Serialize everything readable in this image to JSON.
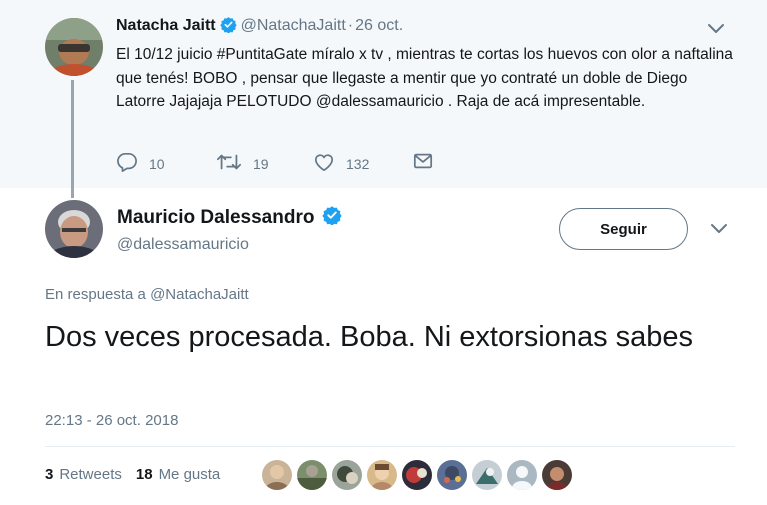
{
  "parent_tweet": {
    "author_name": "Natacha Jaitt",
    "handle": "@NatachaJaitt",
    "separator": "·",
    "date": "26 oct.",
    "text": "El 10/12 juicio #PuntitaGate míralo x tv , mientras te cortas los huevos con olor a naftalina que tenés! BOBO , pensar que llegaste a mentir que yo contraté un doble de Diego Latorre Jajajaja PELOTUDO @dalessamauricio . Raja de acá impresentable.",
    "reply_count": "10",
    "retweet_count": "19",
    "like_count": "132"
  },
  "main_tweet": {
    "author_name": "Mauricio Dalessandro",
    "handle": "@dalessamauricio",
    "follow_label": "Seguir",
    "reply_to_prefix": "En respuesta a",
    "reply_to_handle": "@NatachaJaitt",
    "text": "Dos veces procesada. Boba. Ni extorsionas sabes",
    "timestamp": "22:13 - 26 oct. 2018",
    "retweets_count": "3",
    "retweets_label": "Retweets",
    "likes_count": "18",
    "likes_label": "Me gusta"
  },
  "colors": {
    "verified_blue": "#1da1f2",
    "secondary_text": "#657786",
    "primary_text": "#14171a",
    "parent_background": "#f5f8fa"
  },
  "icons": [
    "verified-badge-icon",
    "chevron-down-icon",
    "reply-icon",
    "retweet-icon",
    "like-icon",
    "direct-message-icon"
  ]
}
